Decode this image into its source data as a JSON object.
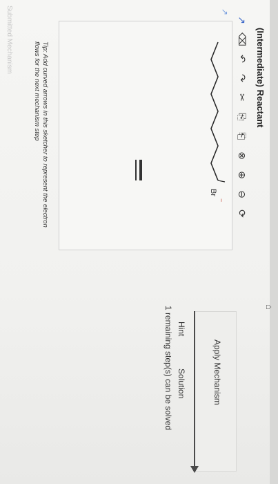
{
  "page": {
    "title": "(Intermediate) Reactant",
    "tip": "Tip: Add curved arrows in this sketcher to represent the electron flows for the next mechanism step",
    "footer_label": "Submitted Mechanism"
  },
  "toolbar": {
    "items": [
      {
        "name": "lasso-icon",
        "glyph": "↗"
      },
      {
        "name": "eraser-icon",
        "glyph": "⌫"
      },
      {
        "name": "undo-icon",
        "glyph": "↶"
      },
      {
        "name": "redo-icon",
        "glyph": "↷"
      },
      {
        "name": "scissors-icon",
        "glyph": "✂"
      },
      {
        "name": "copy-icon",
        "glyph": "⎘"
      },
      {
        "name": "paste-icon",
        "glyph": "⎗"
      },
      {
        "name": "close-circle-icon",
        "glyph": "⊗"
      },
      {
        "name": "zoom-in-icon",
        "glyph": "⊕"
      },
      {
        "name": "zoom-out-icon",
        "glyph": "⊖"
      },
      {
        "name": "refresh-icon",
        "glyph": "⟳"
      }
    ]
  },
  "sketcher": {
    "atom_label": "Br",
    "charge": "−"
  },
  "actions": {
    "apply_label": "Apply Mechanism",
    "hint_label": "Hint",
    "solution_label": "Solution",
    "remaining_text": "1 remaining step(s) can be solved"
  },
  "colors": {
    "accent": "#3a67c8",
    "panel": "#eeeeec",
    "text": "#333333"
  }
}
